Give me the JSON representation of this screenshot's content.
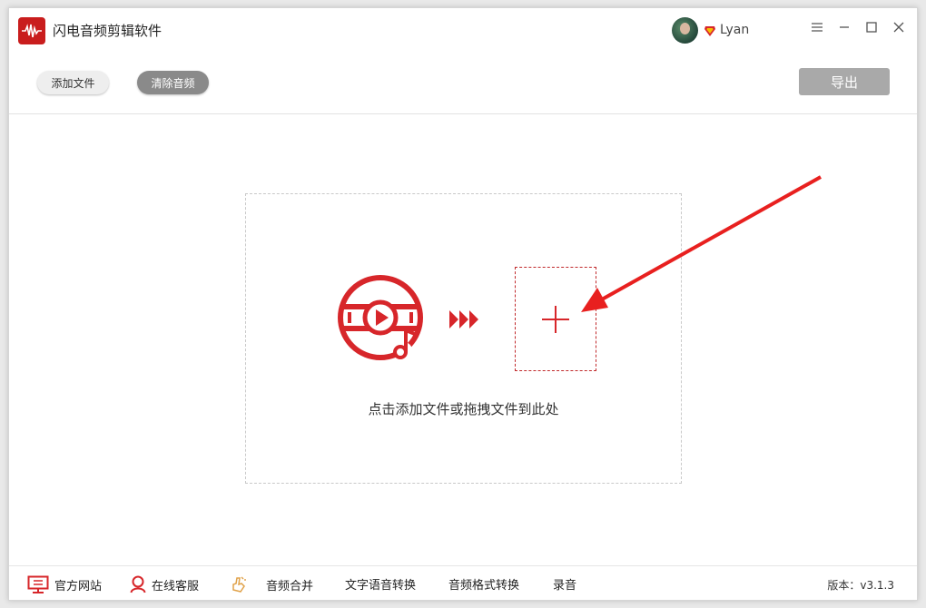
{
  "app": {
    "title": "闪电音频剪辑软件"
  },
  "user": {
    "name": "Lyan"
  },
  "toolbar": {
    "add_file_label": "添加文件",
    "clear_audio_label": "清除音频",
    "export_label": "导出"
  },
  "dropzone": {
    "hint": "点击添加文件或拖拽文件到此处"
  },
  "footer": {
    "official_site": "官方网站",
    "online_service": "在线客服",
    "audio_merge": "音频合并",
    "text_to_speech": "文字语音转换",
    "format_convert": "音频格式转换",
    "record": "录音",
    "version": "版本：v3.1.3"
  },
  "colors": {
    "accent": "#d7262a",
    "brand": "#c91d1d",
    "export_disabled": "#a9a9a9",
    "clear_button": "#8a8a8a"
  },
  "icons": {
    "app_logo": "waveform-logo-icon",
    "vip": "diamond-vip-icon",
    "minimize": "menu-lines-icon",
    "min": "minimize-icon",
    "max": "maximize-icon",
    "close": "close-icon",
    "disc": "music-disc-icon",
    "forward": "triple-chevron-icon",
    "add": "plus-icon",
    "monitor": "monitor-icon",
    "person": "person-icon",
    "hand": "hand-icon"
  }
}
